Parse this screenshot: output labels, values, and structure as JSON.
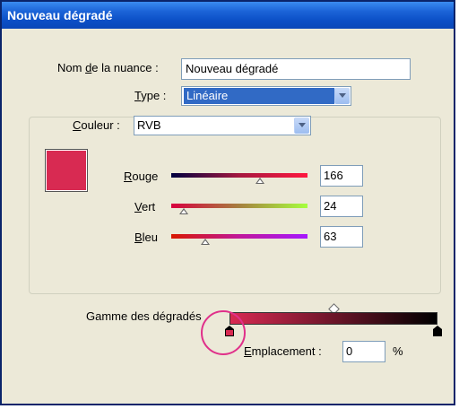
{
  "window": {
    "title": "Nouveau dégradé"
  },
  "swatch_name": {
    "label_pre": "Nom ",
    "label_u": "d",
    "label_post": "e la nuance :",
    "value": "Nouveau dégradé"
  },
  "type": {
    "label_u": "T",
    "label_post": "ype :",
    "value": "Linéaire"
  },
  "stop_color": {
    "label_u": "C",
    "label_post": "ouleur :",
    "mode": "RVB",
    "swatch_color": "#d82a52",
    "channels": [
      {
        "label_u": "R",
        "label_post": "ouge",
        "value": "166",
        "fraction": 0.651
      },
      {
        "label_u": "V",
        "label_post": "ert",
        "value": "24",
        "fraction": 0.094
      },
      {
        "label_u": "B",
        "label_post": "leu",
        "value": "63",
        "fraction": 0.247
      }
    ]
  },
  "gradient_ramp": {
    "label": "Gamme des dégradés",
    "start_color": "#d82a52",
    "end_color": "#000000",
    "selected_stop_color": "#d82a52",
    "end_stop_color": "#000000"
  },
  "location": {
    "label_u": "E",
    "label_post": "mplacement :",
    "value": "0",
    "unit": "%"
  }
}
